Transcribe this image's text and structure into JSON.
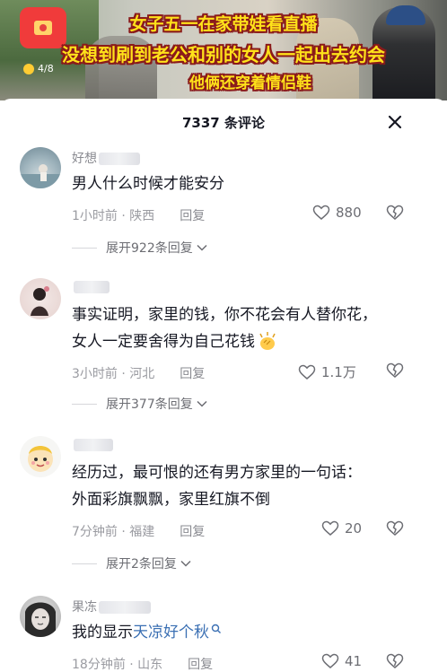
{
  "video": {
    "caption_line1": "女子五一在家带娃看直播",
    "caption_line2": "没想到刷到老公和别的女人一起出去约会",
    "caption_line3": "他俩还穿着情侣鞋",
    "counter": "4/8"
  },
  "panel": {
    "title": "7337 条评论",
    "close_icon": "close-icon"
  },
  "comments": [
    {
      "username": "好想",
      "text": "男人什么时候才能安分",
      "time": "1小时前 · 陕西",
      "reply": "回复",
      "likes": "880",
      "expand": "展开922条回复"
    },
    {
      "username": "",
      "text_line1": "事实证明，家里的钱，你不花会有人替你花，",
      "text_line2": "女人一定要舍得为自己花钱",
      "time": "3小时前 · 河北",
      "reply": "回复",
      "likes": "1.1万",
      "expand": "展开377条回复"
    },
    {
      "username": "",
      "text_line1": "经历过，最可恨的还有男方家里的一句话：",
      "text_line2": "外面彩旗飘飘，家里红旗不倒",
      "time": "7分钟前 · 福建",
      "reply": "回复",
      "likes": "20",
      "expand": "展开2条回复"
    },
    {
      "username": "果冻",
      "text_plain": "我的显示",
      "text_link": "天凉好个秋",
      "time": "18分钟前 · 山东",
      "reply": "回复",
      "likes": "41"
    }
  ],
  "colors": {
    "accent_link": "#3a6fb3",
    "caption_yellow": "#ffe21a",
    "caption_outline": "#8a1a1a"
  }
}
